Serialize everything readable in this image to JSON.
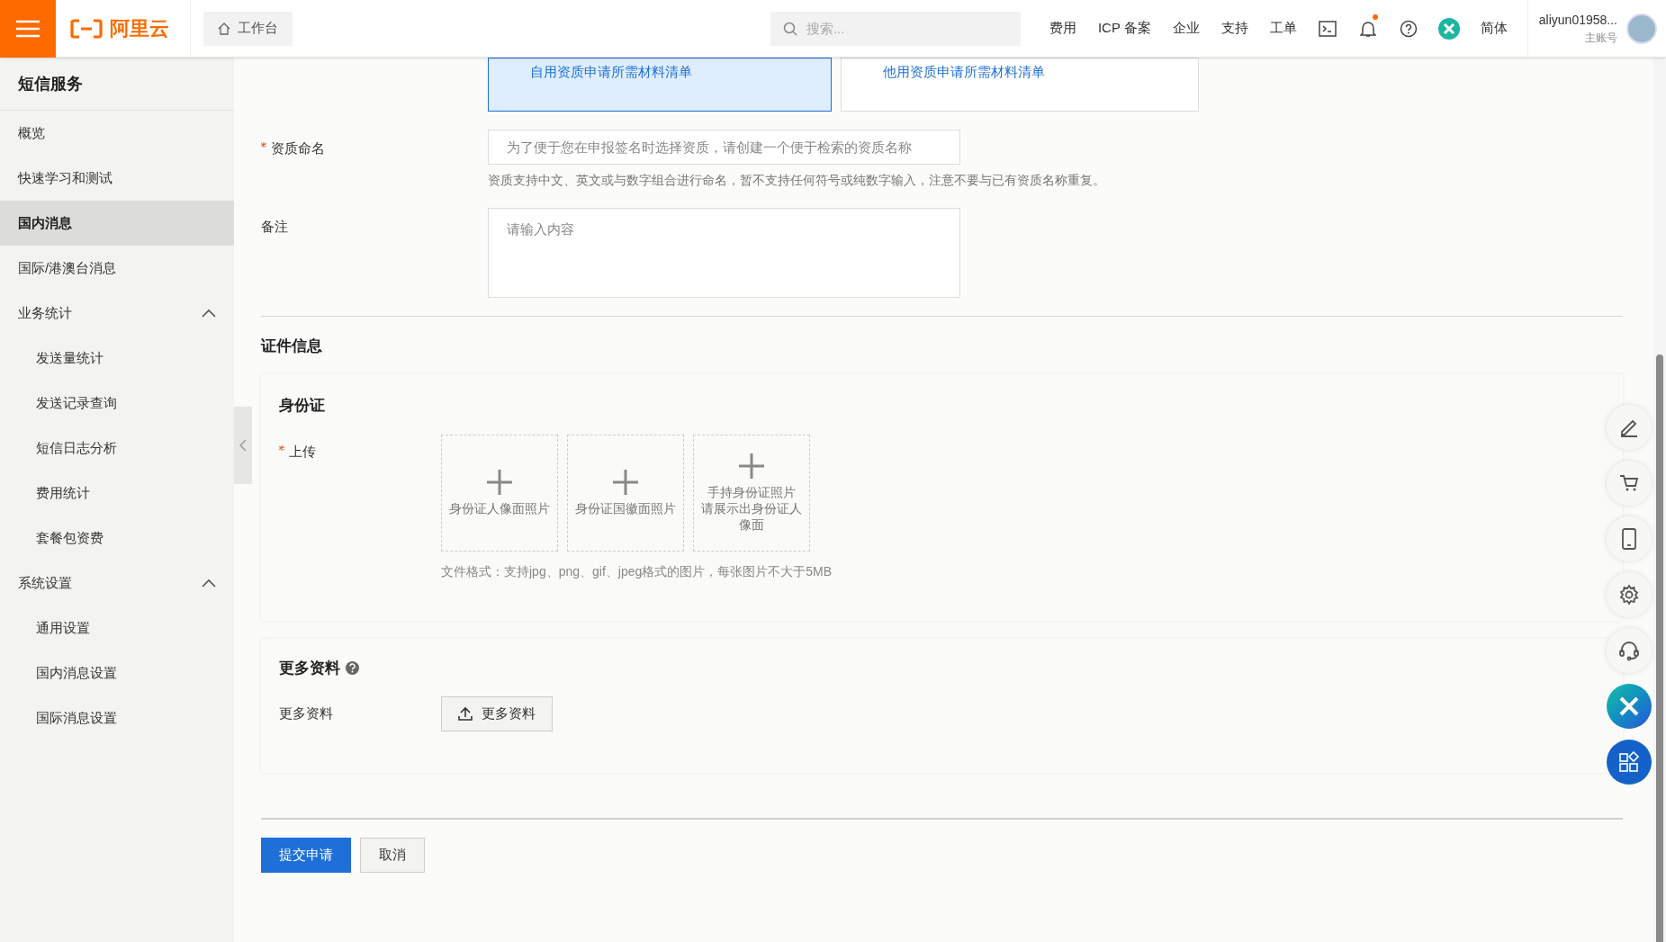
{
  "topbar": {
    "logo": "阿里云",
    "workbench": "工作台",
    "search_placeholder": "搜索...",
    "links": [
      "费用",
      "ICP 备案",
      "企业",
      "支持",
      "工单"
    ],
    "language": "简体",
    "account": "aliyun01958...",
    "account_type": "主账号",
    "notification_dot": true
  },
  "sidebar": {
    "title": "短信服务",
    "items": [
      {
        "label": "概览",
        "selected": false
      },
      {
        "label": "快速学习和测试",
        "selected": false
      },
      {
        "label": "国内消息",
        "selected": true
      },
      {
        "label": "国际/港澳台消息",
        "selected": false
      },
      {
        "label": "业务统计",
        "selected": false,
        "expanded": true,
        "children": [
          {
            "label": "发送量统计",
            "selected": false
          },
          {
            "label": "发送记录查询",
            "selected": false
          },
          {
            "label": "短信日志分析",
            "selected": false
          },
          {
            "label": "费用统计",
            "selected": false
          },
          {
            "label": "套餐包资费",
            "selected": false
          }
        ]
      },
      {
        "label": "系统设置",
        "selected": false,
        "expanded": true,
        "children": [
          {
            "label": "通用设置",
            "selected": false
          },
          {
            "label": "国内消息设置",
            "selected": false
          },
          {
            "label": "国际消息设置",
            "selected": false
          }
        ]
      }
    ]
  },
  "material_options": [
    {
      "label": "自用资质申请所需材料清单",
      "selected": true
    },
    {
      "label": "他用资质申请所需材料清单",
      "selected": false
    }
  ],
  "form": {
    "name_label": "资质命名",
    "name_required": true,
    "name_placeholder": "为了便于您在申报签名时选择资质，请创建一个便于检索的资质名称",
    "name_hint": "资质支持中文、英文或与数字组合进行命名，暂不支持任何符号或纯数字输入，注意不要与已有资质名称重复。",
    "remark_label": "备注",
    "remark_placeholder": "请输入内容"
  },
  "certificate": {
    "section_title": "证件信息",
    "card_title": "身份证",
    "upload_label": "上传",
    "upload_required": true,
    "upload_slots": [
      [
        "身份证人像面照片"
      ],
      [
        "身份证国徽面照片"
      ],
      [
        "手持身份证照片",
        "请展示出身份证人",
        "像面"
      ]
    ],
    "format_hint": "文件格式：支持jpg、png、gif、jpeg格式的图片，每张图片不大于5MB"
  },
  "more": {
    "title": "更多资料",
    "label": "更多资料",
    "button": "更多资料"
  },
  "actions": {
    "submit": "提交申请",
    "cancel": "取消"
  }
}
